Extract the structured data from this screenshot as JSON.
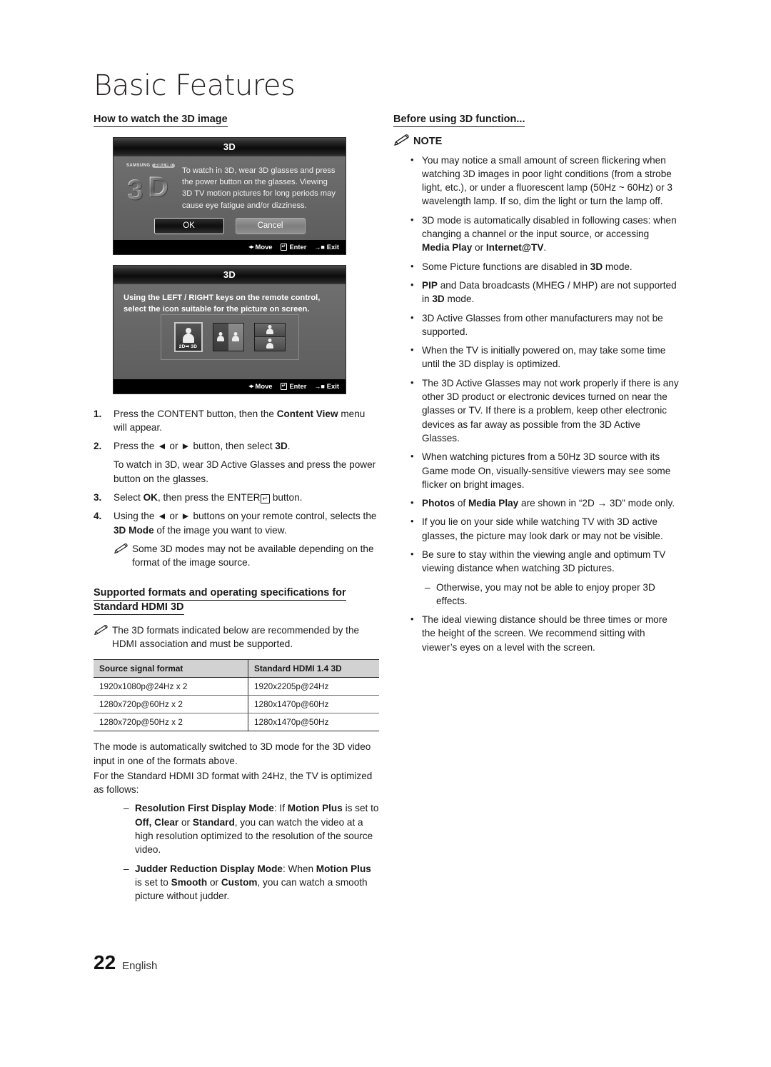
{
  "chapter": {
    "title": "Basic Features"
  },
  "left": {
    "heading": "How to watch the 3D image",
    "dialog1": {
      "title": "3D",
      "brand": "SAMSUNG",
      "brand_badge": "FULL HD",
      "cube_left": "3",
      "cube_right": "D",
      "message": "To watch in 3D, wear 3D glasses and press the power button on the glasses. Viewing 3D TV motion pictures for long periods may cause eye fatigue and/or dizziness.",
      "ok_label": "OK",
      "cancel_label": "Cancel",
      "footer": {
        "move": "Move",
        "enter": "Enter",
        "exit": "Exit"
      }
    },
    "dialog2": {
      "title": "3D",
      "message": "Using the LEFT / RIGHT keys on the remote control, select the icon suitable for the picture on screen.",
      "mode_icons": [
        {
          "name": "2d-to-3d",
          "label": "2D➡ 3D",
          "selected": true
        },
        {
          "name": "side-by-side",
          "label": "",
          "selected": false
        },
        {
          "name": "top-bottom",
          "label": "",
          "selected": false
        }
      ],
      "footer": {
        "move": "Move",
        "enter": "Enter",
        "exit": "Exit"
      }
    },
    "steps": [
      {
        "num": "1.",
        "html": "Press the CONTENT button, then the <b>Content View</b> menu will appear."
      },
      {
        "num": "2.",
        "html": "Press the ◄ or ► button, then select <b>3D</b>."
      },
      {
        "num": "3.",
        "html": "Select <b>OK</b>, then press the ENTER<span class=\"glyph-enter\" style=\"border-color:#1a1a1a;color:#1a1a1a;font-size:9px;line-height:11px;padding:0 2px;\">↵</span> button."
      },
      {
        "num": "4.",
        "html": "Using the ◄ or ► buttons on your remote control, selects the <b>3D Mode</b> of the image you want to view."
      }
    ],
    "step2_para": "To watch in 3D, wear 3D Active Glasses and press the power button on the glasses.",
    "step4_note": "Some 3D modes may not be available depending on the format of the image source.",
    "spec_heading": "Supported formats and operating specifications for Standard HDMI 3D",
    "spec_note": "The 3D formats indicated below are recommended by the HDMI association and must be supported.",
    "table": {
      "headers": [
        "Source signal format",
        "Standard HDMI 1.4 3D"
      ],
      "rows": [
        [
          "1920x1080p@24Hz x 2",
          "1920x2205p@24Hz"
        ],
        [
          "1280x720p@60Hz x 2",
          "1280x1470p@60Hz"
        ],
        [
          "1280x720p@50Hz x 2",
          "1280x1470p@50Hz"
        ]
      ]
    },
    "after_table_p1": "The mode is automatically switched to 3D mode for the 3D video input in one of the formats above.",
    "after_table_p2": "For the Standard HDMI 3D format with 24Hz, the TV is optimized as follows:",
    "dash_items": [
      {
        "dash": "–",
        "html": "<b>Resolution First Display Mode</b>: If <b>Motion Plus</b> is set to <b>Off, Clear</b> or <b>Standard</b>, you can watch the video at a high resolution optimized to the resolution of the source video."
      },
      {
        "dash": "–",
        "html": "<b>Judder Reduction Display Mode</b>: When <b>Motion Plus</b> is set to <b>Smooth</b> or <b>Custom</b>, you can watch a smooth picture without judder."
      }
    ]
  },
  "right": {
    "heading": "Before using 3D function...",
    "note_label": "NOTE",
    "bullets": [
      {
        "b": "•",
        "html": "You may notice a small amount of screen flickering when watching 3D images in poor light conditions (from a strobe light, etc.), or under a fluorescent lamp (50Hz ~ 60Hz) or 3 wavelength lamp. If so, dim the light or turn the lamp off."
      },
      {
        "b": "•",
        "html": "3D mode is automatically disabled in following cases: when changing a channel or the input source, or accessing <b>Media Play</b> or <b>Internet@TV</b>."
      },
      {
        "b": "•",
        "html": "Some Picture functions are disabled in <b>3D</b> mode."
      },
      {
        "b": "•",
        "html": "<b>PIP</b> and Data broadcasts (MHEG / MHP) are not supported in <b>3D</b> mode."
      },
      {
        "b": "•",
        "html": "3D Active Glasses from other manufacturers may not be supported."
      },
      {
        "b": "•",
        "html": "When the TV is initially powered on, may take some time until the 3D display is optimized."
      },
      {
        "b": "•",
        "html": "The 3D Active Glasses may not work properly if there is any other 3D product or electronic devices turned on near the glasses or TV. If there is a problem, keep other electronic devices as far away as possible from the 3D Active Glasses."
      },
      {
        "b": "•",
        "html": "When watching pictures from a 50Hz 3D source with its Game mode On, visually-sensitive viewers may see some flicker on bright images."
      },
      {
        "b": "•",
        "html": "<b>Photos</b> of <b>Media Play</b> are shown in “2D → 3D” mode only."
      },
      {
        "b": "•",
        "html": "If you lie on your side while watching TV with 3D active glasses, the picture may look dark or may not be visible."
      },
      {
        "b": "•",
        "html": "Be sure to stay within the viewing angle and optimum TV viewing distance when watching 3D pictures."
      }
    ],
    "sub_dash": {
      "d": "–",
      "text": "Otherwise, you may not be able to enjoy proper 3D effects."
    },
    "last_bullet": {
      "b": "•",
      "html": "The ideal viewing distance should be three times or more the height of the screen. We recommend sitting with viewer’s eyes on a level with the screen."
    }
  },
  "footer": {
    "page_number": "22",
    "language": "English"
  }
}
